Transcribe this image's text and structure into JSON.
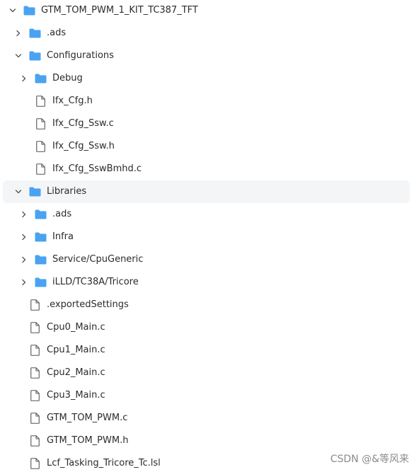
{
  "tree": {
    "root": {
      "label": "GTM_TOM_PWM_1_KIT_TC387_TFT",
      "expanded": true,
      "type": "folder",
      "icon": "folder-icon"
    },
    "items": [
      {
        "label": ".ads",
        "type": "folder",
        "expanded": false,
        "icon": "folder-icon"
      },
      {
        "label": "Configurations",
        "type": "folder",
        "expanded": true,
        "icon": "folder-icon"
      },
      {
        "label": "Debug",
        "type": "folder",
        "expanded": false,
        "icon": "folder-icon"
      },
      {
        "label": "Ifx_Cfg.h",
        "type": "file",
        "icon": "file-icon"
      },
      {
        "label": "Ifx_Cfg_Ssw.c",
        "type": "file",
        "icon": "file-icon"
      },
      {
        "label": "Ifx_Cfg_Ssw.h",
        "type": "file",
        "icon": "file-icon"
      },
      {
        "label": "Ifx_Cfg_SswBmhd.c",
        "type": "file",
        "icon": "file-icon"
      },
      {
        "label": "Libraries",
        "type": "folder",
        "expanded": true,
        "icon": "folder-icon",
        "highlighted": true
      },
      {
        "label": ".ads",
        "type": "folder",
        "expanded": false,
        "icon": "folder-icon"
      },
      {
        "label": "Infra",
        "type": "folder",
        "expanded": false,
        "icon": "folder-icon"
      },
      {
        "label": "Service/CpuGeneric",
        "type": "folder",
        "expanded": false,
        "icon": "folder-icon"
      },
      {
        "label": "iLLD/TC38A/Tricore",
        "type": "folder",
        "expanded": false,
        "icon": "folder-icon"
      },
      {
        "label": ".exportedSettings",
        "type": "file",
        "icon": "file-icon"
      },
      {
        "label": "Cpu0_Main.c",
        "type": "file",
        "icon": "file-icon"
      },
      {
        "label": "Cpu1_Main.c",
        "type": "file",
        "icon": "file-icon"
      },
      {
        "label": "Cpu2_Main.c",
        "type": "file",
        "icon": "file-icon"
      },
      {
        "label": "Cpu3_Main.c",
        "type": "file",
        "icon": "file-icon"
      },
      {
        "label": "GTM_TOM_PWM.c",
        "type": "file",
        "icon": "file-icon"
      },
      {
        "label": "GTM_TOM_PWM.h",
        "type": "file",
        "icon": "file-icon"
      },
      {
        "label": "Lcf_Tasking_Tricore_Tc.lsl",
        "type": "file",
        "icon": "file-icon"
      }
    ]
  },
  "watermark": "CSDN @&等风来",
  "colors": {
    "folder": "#4aa3f0",
    "file_outline": "#555555",
    "chevron": "#555555",
    "highlight_bg": "#f4f5f7",
    "text": "#2b2b2b",
    "watermark": "#8a8a8a"
  }
}
